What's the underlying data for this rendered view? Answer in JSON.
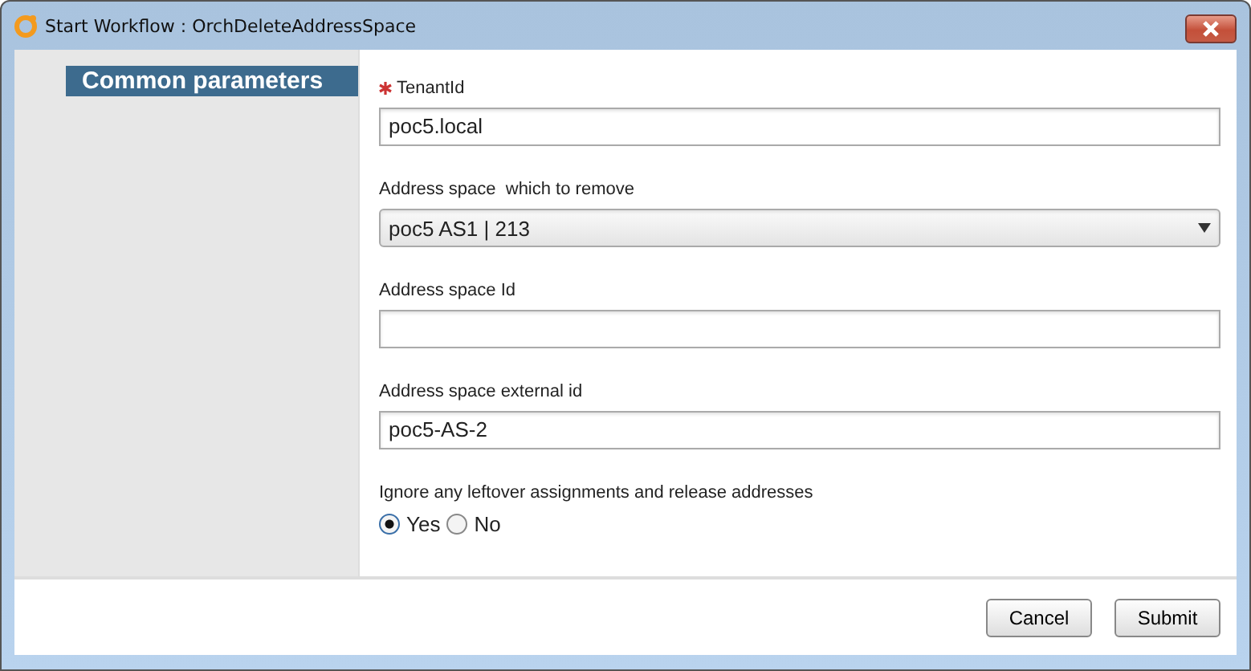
{
  "window": {
    "title": "Start Workflow : OrchDeleteAddressSpace"
  },
  "sidebar": {
    "items": [
      {
        "label": "Common parameters",
        "selected": true
      }
    ]
  },
  "fields": [
    {
      "kind": "text",
      "label": "TenantId",
      "required": true,
      "value": "poc5.local"
    },
    {
      "kind": "select",
      "label": "Address space  which to remove",
      "required": false,
      "value": "poc5 AS1 | 213"
    },
    {
      "kind": "text",
      "label": "Address space Id",
      "required": false
    },
    {
      "kind": "text",
      "label": "Address space external id",
      "required": false,
      "value": "poc5-AS-2"
    },
    {
      "kind": "radio",
      "label": "Ignore any leftover assignments and release addresses",
      "required": false,
      "options": [
        {
          "label": "Yes",
          "selected": true
        },
        {
          "label": "No",
          "selected": false
        }
      ]
    }
  ],
  "buttons": [
    "Cancel",
    "Submit"
  ]
}
